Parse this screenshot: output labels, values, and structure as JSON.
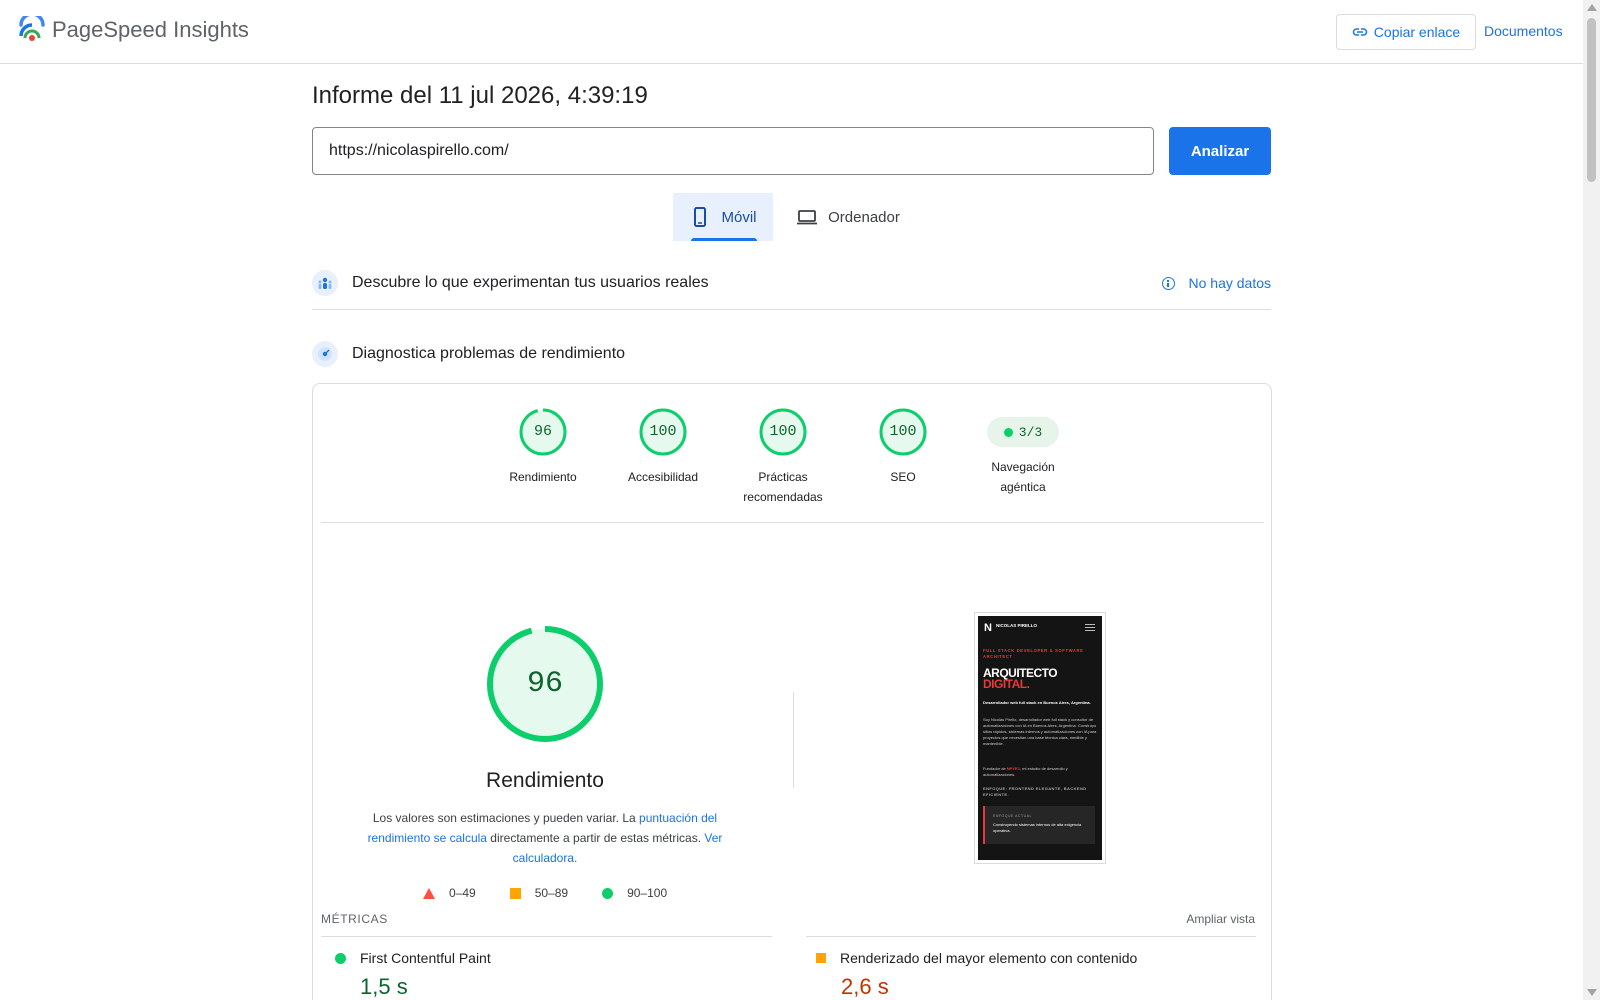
{
  "header": {
    "brand": "PageSpeed Insights",
    "copy_link": "Copiar enlace",
    "docs": "Documentos"
  },
  "report": {
    "title": "Informe del 11 jul 2026, 4:39:19",
    "url": "https://nicolaspirello.com/",
    "analyze": "Analizar"
  },
  "tabs": [
    {
      "label": "Móvil",
      "active": true
    },
    {
      "label": "Ordenador",
      "active": false
    }
  ],
  "field_data": {
    "title": "Descubre lo que experimentan tus usuarios reales",
    "status": "No hay datos"
  },
  "lab_data": {
    "title": "Diagnostica problemas de rendimiento"
  },
  "scores": [
    {
      "value": "96",
      "label": "Rendimiento",
      "fraction": 0.96
    },
    {
      "value": "100",
      "label": "Accesibilidad",
      "fraction": 1.0
    },
    {
      "value": "100",
      "label": "Prácticas recomendadas",
      "fraction": 1.0
    },
    {
      "value": "100",
      "label": "SEO",
      "fraction": 1.0
    }
  ],
  "agentic": {
    "value": "3/3",
    "label": "Navegación agéntica"
  },
  "performance": {
    "score": "96",
    "fraction": 0.96,
    "title": "Rendimiento",
    "note_1": "Los valores son estimaciones y pueden variar. La ",
    "note_link_1": "puntuación del rendimiento se calcula",
    "note_2": " directamente a partir de estas métricas. ",
    "note_link_2": "Ver calculadora."
  },
  "legend": [
    {
      "range": "0–49",
      "color": "#ff4e42"
    },
    {
      "range": "50–89",
      "color": "#ffa400"
    },
    {
      "range": "90–100",
      "color": "#0cce6b"
    }
  ],
  "screenshot": {
    "logo": "N",
    "brand": "NICOLAS PIRELLO",
    "subtitle": "FULL STACK DEVELOPER & SOFTWARE ARCHITECT",
    "heading_1": "ARQUITECTO",
    "heading_2": "DIGITAL.",
    "lead": "Desarrollador web full stack en Buenos Aires, Argentina.",
    "body": "Soy Nicolás Pirello, desarrollador web full stack y consultor de automatizaciones con IA en Buenos Aires, Argentina. Construyo sitios rápidos, sistemas internos y automatizaciones con IA para proyectos que necesitan una base técnica clara, medible y mantenible.",
    "founder_1": "Fundador de ",
    "founder_brand": "NPYE1",
    "founder_2": ", mi estudio de desarrollo y automatizaciones.",
    "focus": "ENFOQUE: FRONTEND ELEGANTE, BACKEND EFICIENTE.",
    "box_label": "ENFOQUE ACTUAL",
    "box_text": "Construyendo sistemas internos de alta exigencia operativa."
  },
  "metrics": {
    "header": "MÉTRICAS",
    "expand": "Ampliar vista",
    "items": [
      {
        "name": "First Contentful Paint",
        "value": "1,5 s",
        "status": "good",
        "color": "#0cce6b"
      },
      {
        "name": "Renderizado del mayor elemento con contenido",
        "value": "2,6 s",
        "status": "average",
        "color": "#ffa400"
      }
    ]
  },
  "colors": {
    "accent": "#1a73e8",
    "good": "#0cce6b",
    "good_text": "#0d652d",
    "average_text": "#c33300"
  }
}
